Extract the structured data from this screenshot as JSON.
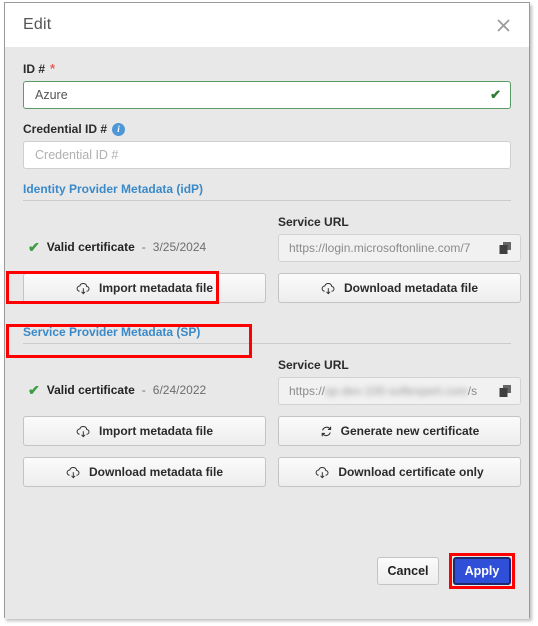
{
  "window": {
    "title": "Edit",
    "close_icon": "close-icon"
  },
  "form": {
    "id_field": {
      "label": "ID #",
      "required_marker": "*",
      "value": "Azure",
      "valid_icon": "✔"
    },
    "credential_field": {
      "label": "Credential ID #",
      "info_icon": "i",
      "placeholder": "Credential ID #",
      "value": ""
    }
  },
  "idp_section": {
    "heading": "Identity Provider Metadata (idP)",
    "certificate": {
      "check": "✔",
      "label": "Valid certificate",
      "separator": "-",
      "date": "3/25/2024"
    },
    "service_url": {
      "label": "Service URL",
      "value": "https://login.microsoftonline.com/7",
      "copy_icon": "copy-icon"
    },
    "buttons": {
      "import": "Import metadata file",
      "download": "Download metadata file"
    }
  },
  "sp_section": {
    "heading": "Service Provider Metadata (SP)",
    "certificate": {
      "check": "✔",
      "label": "Valid certificate",
      "separator": "-",
      "date": "6/24/2022"
    },
    "service_url": {
      "label": "Service URL",
      "value_prefix": "https://",
      "value_redacted": "sp-dev-100-softexpert.com",
      "value_suffix": "/s",
      "copy_icon": "copy-icon"
    },
    "buttons": {
      "import": "Import metadata file",
      "generate": "Generate new certificate",
      "download": "Download metadata file",
      "download_cert": "Download certificate only"
    }
  },
  "footer": {
    "cancel": "Cancel",
    "apply": "Apply"
  },
  "colors": {
    "accent_blue": "#3a8ac9",
    "apply_blue": "#2f4fd8",
    "valid_green": "#3f9c45",
    "annotation_red": "#ff0000",
    "required_red": "#e8615f"
  }
}
